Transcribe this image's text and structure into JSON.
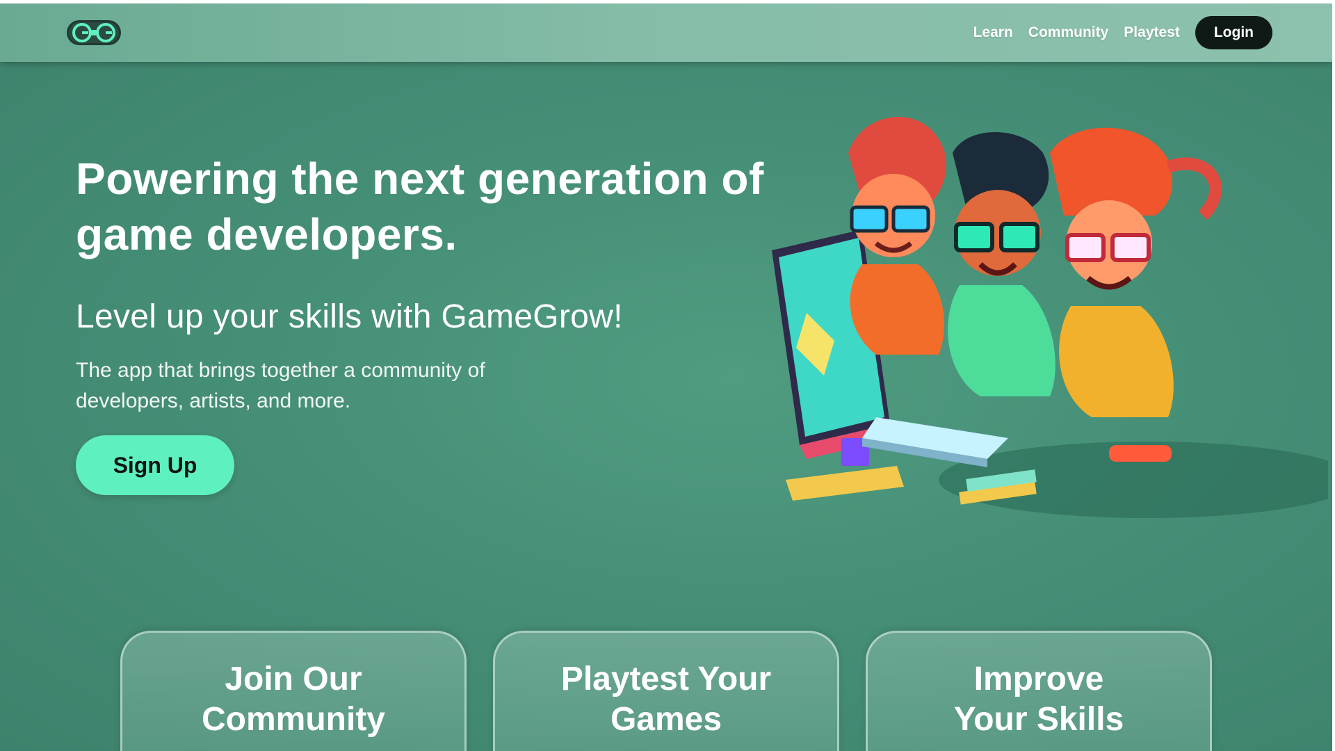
{
  "header": {
    "logo_alt": "GG",
    "nav": [
      {
        "label": "Learn"
      },
      {
        "label": "Community"
      },
      {
        "label": "Playtest"
      }
    ],
    "login_label": "Login"
  },
  "hero": {
    "headline": "Powering the next generation of game developers.",
    "subheadline": "Level up your skills with GameGrow!",
    "description": "The app that brings together a community of developers, artists, and more.",
    "cta_label": "Sign Up"
  },
  "features": [
    {
      "title": "Join Our\nCommunity"
    },
    {
      "title": "Playtest Your\nGames"
    },
    {
      "title": "Improve\nYour Skills"
    }
  ],
  "colors": {
    "background": "#4a957b",
    "nav_bg": "#86bda8",
    "cta": "#5ff0c0",
    "login_bg": "#0f1a17"
  },
  "icons": {
    "logo": "controller-gg-logo"
  }
}
